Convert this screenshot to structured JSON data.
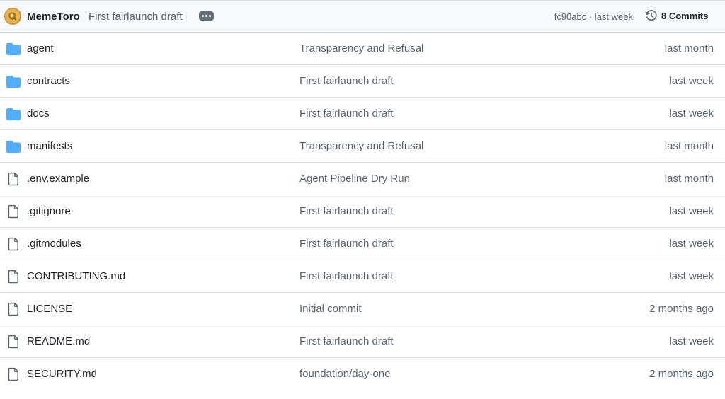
{
  "header": {
    "author": "MemeToro",
    "commit_message": "First fairlaunch draft",
    "commit_meta": "fc90abc · last week",
    "commits_label": "8 Commits"
  },
  "files": [
    {
      "name": "agent",
      "type": "folder",
      "commit": "Transparency and Refusal",
      "date": "last month"
    },
    {
      "name": "contracts",
      "type": "folder",
      "commit": "First fairlaunch draft",
      "date": "last week"
    },
    {
      "name": "docs",
      "type": "folder",
      "commit": "First fairlaunch draft",
      "date": "last week"
    },
    {
      "name": "manifests",
      "type": "folder",
      "commit": "Transparency and Refusal",
      "date": "last month"
    },
    {
      "name": ".env.example",
      "type": "file",
      "commit": "Agent Pipeline Dry Run",
      "date": "last month"
    },
    {
      "name": ".gitignore",
      "type": "file",
      "commit": "First fairlaunch draft",
      "date": "last week"
    },
    {
      "name": ".gitmodules",
      "type": "file",
      "commit": "First fairlaunch draft",
      "date": "last week"
    },
    {
      "name": "CONTRIBUTING.md",
      "type": "file",
      "commit": "First fairlaunch draft",
      "date": "last week"
    },
    {
      "name": "LICENSE",
      "type": "file",
      "commit": "Initial commit",
      "date": "2 months ago"
    },
    {
      "name": "README.md",
      "type": "file",
      "commit": "First fairlaunch draft",
      "date": "last week"
    },
    {
      "name": "SECURITY.md",
      "type": "file",
      "commit": "foundation/day-one",
      "date": "2 months ago"
    }
  ],
  "colors": {
    "folder": "#54aeff",
    "file_icon": "#59636e",
    "muted_text": "#59636e",
    "header_bg": "#f6f8fa",
    "border": "#d0d7de"
  },
  "icons": {
    "folder": "folder-icon",
    "file": "file-icon",
    "history": "history-icon",
    "ellipsis": "kebab-horizontal-icon"
  }
}
